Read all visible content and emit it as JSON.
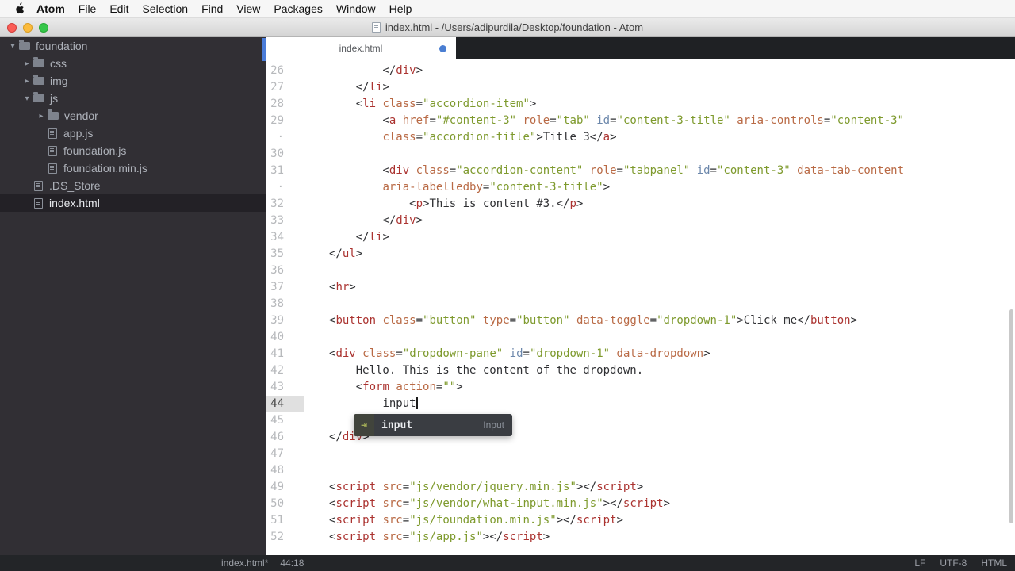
{
  "colors": {
    "accent_blue": "#4a7ed2",
    "tree_selection": "#232126",
    "tag_red": "#ab3330",
    "attr_orange": "#b96a45",
    "id_blue": "#6c87ab",
    "string_green": "#7e9a2d"
  },
  "menubar": {
    "app": "Atom",
    "items": [
      "File",
      "Edit",
      "Selection",
      "Find",
      "View",
      "Packages",
      "Window",
      "Help"
    ]
  },
  "titlebar": {
    "title": "index.html - /Users/adipurdila/Desktop/foundation - Atom"
  },
  "tree": {
    "items": [
      {
        "label": "foundation",
        "type": "folder",
        "depth": 0,
        "chevron": "down"
      },
      {
        "label": "css",
        "type": "folder",
        "depth": 1,
        "chevron": "right"
      },
      {
        "label": "img",
        "type": "folder",
        "depth": 1,
        "chevron": "right"
      },
      {
        "label": "js",
        "type": "folder",
        "depth": 1,
        "chevron": "down"
      },
      {
        "label": "vendor",
        "type": "folder",
        "depth": 2,
        "chevron": "right"
      },
      {
        "label": "app.js",
        "type": "file",
        "depth": 2
      },
      {
        "label": "foundation.js",
        "type": "file",
        "depth": 2
      },
      {
        "label": "foundation.min.js",
        "type": "file",
        "depth": 2
      },
      {
        "label": ".DS_Store",
        "type": "file",
        "depth": 1
      },
      {
        "label": "index.html",
        "type": "file",
        "depth": 1,
        "selected": true
      }
    ]
  },
  "tab": {
    "label": "index.html",
    "modified": true
  },
  "editor": {
    "rows": [
      {
        "n": "26",
        "i": 8,
        "t": [
          [
            "p",
            "</"
          ],
          [
            "t",
            "div"
          ],
          [
            "p",
            ">"
          ]
        ]
      },
      {
        "n": "27",
        "i": 4,
        "t": [
          [
            "p",
            "</"
          ],
          [
            "t",
            "li"
          ],
          [
            "p",
            ">"
          ]
        ]
      },
      {
        "n": "28",
        "i": 4,
        "t": [
          [
            "p",
            "<"
          ],
          [
            "t",
            "li"
          ],
          [
            "x",
            " "
          ],
          [
            "a",
            "class"
          ],
          [
            "p",
            "="
          ],
          [
            "s",
            "\"accordion-item\""
          ],
          [
            "p",
            ">"
          ]
        ]
      },
      {
        "n": "29",
        "i": 8,
        "t": [
          [
            "p",
            "<"
          ],
          [
            "t",
            "a"
          ],
          [
            "x",
            " "
          ],
          [
            "a",
            "href"
          ],
          [
            "p",
            "="
          ],
          [
            "s",
            "\"#content-3\""
          ],
          [
            "x",
            " "
          ],
          [
            "a",
            "role"
          ],
          [
            "p",
            "="
          ],
          [
            "s",
            "\"tab\""
          ],
          [
            "x",
            " "
          ],
          [
            "i",
            "id"
          ],
          [
            "p",
            "="
          ],
          [
            "s",
            "\"content-3-title\""
          ],
          [
            "x",
            " "
          ],
          [
            "a",
            "aria-controls"
          ],
          [
            "p",
            "="
          ],
          [
            "s",
            "\"content-3\""
          ]
        ]
      },
      {
        "n": "·",
        "i": 8,
        "t": [
          [
            "a",
            "class"
          ],
          [
            "p",
            "="
          ],
          [
            "s",
            "\"accordion-title\""
          ],
          [
            "p",
            ">"
          ],
          [
            "x",
            "Title 3"
          ],
          [
            "p",
            "</"
          ],
          [
            "t",
            "a"
          ],
          [
            "p",
            ">"
          ]
        ]
      },
      {
        "n": "30",
        "i": 0,
        "t": []
      },
      {
        "n": "31",
        "i": 8,
        "t": [
          [
            "p",
            "<"
          ],
          [
            "t",
            "div"
          ],
          [
            "x",
            " "
          ],
          [
            "a",
            "class"
          ],
          [
            "p",
            "="
          ],
          [
            "s",
            "\"accordion-content\""
          ],
          [
            "x",
            " "
          ],
          [
            "a",
            "role"
          ],
          [
            "p",
            "="
          ],
          [
            "s",
            "\"tabpanel\""
          ],
          [
            "x",
            " "
          ],
          [
            "i",
            "id"
          ],
          [
            "p",
            "="
          ],
          [
            "s",
            "\"content-3\""
          ],
          [
            "x",
            " "
          ],
          [
            "a",
            "data-tab-content"
          ]
        ]
      },
      {
        "n": "·",
        "i": 8,
        "t": [
          [
            "a",
            "aria-labelledby"
          ],
          [
            "p",
            "="
          ],
          [
            "s",
            "\"content-3-title\""
          ],
          [
            "p",
            ">"
          ]
        ]
      },
      {
        "n": "32",
        "i": 12,
        "t": [
          [
            "p",
            "<"
          ],
          [
            "t",
            "p"
          ],
          [
            "p",
            ">"
          ],
          [
            "x",
            "This is content #3."
          ],
          [
            "p",
            "</"
          ],
          [
            "t",
            "p"
          ],
          [
            "p",
            ">"
          ]
        ]
      },
      {
        "n": "33",
        "i": 8,
        "t": [
          [
            "p",
            "</"
          ],
          [
            "t",
            "div"
          ],
          [
            "p",
            ">"
          ]
        ]
      },
      {
        "n": "34",
        "i": 4,
        "t": [
          [
            "p",
            "</"
          ],
          [
            "t",
            "li"
          ],
          [
            "p",
            ">"
          ]
        ]
      },
      {
        "n": "35",
        "i": 0,
        "t": [
          [
            "p",
            "</"
          ],
          [
            "t",
            "ul"
          ],
          [
            "p",
            ">"
          ]
        ]
      },
      {
        "n": "36",
        "i": 0,
        "t": []
      },
      {
        "n": "37",
        "i": 0,
        "t": [
          [
            "p",
            "<"
          ],
          [
            "t",
            "hr"
          ],
          [
            "p",
            ">"
          ]
        ]
      },
      {
        "n": "38",
        "i": 0,
        "t": []
      },
      {
        "n": "39",
        "i": 0,
        "t": [
          [
            "p",
            "<"
          ],
          [
            "t",
            "button"
          ],
          [
            "x",
            " "
          ],
          [
            "a",
            "class"
          ],
          [
            "p",
            "="
          ],
          [
            "s",
            "\"button\""
          ],
          [
            "x",
            " "
          ],
          [
            "a",
            "type"
          ],
          [
            "p",
            "="
          ],
          [
            "s",
            "\"button\""
          ],
          [
            "x",
            " "
          ],
          [
            "a",
            "data-toggle"
          ],
          [
            "p",
            "="
          ],
          [
            "s",
            "\"dropdown-1\""
          ],
          [
            "p",
            ">"
          ],
          [
            "x",
            "Click me"
          ],
          [
            "p",
            "</"
          ],
          [
            "t",
            "button"
          ],
          [
            "p",
            ">"
          ]
        ]
      },
      {
        "n": "40",
        "i": 0,
        "t": []
      },
      {
        "n": "41",
        "i": 0,
        "t": [
          [
            "p",
            "<"
          ],
          [
            "t",
            "div"
          ],
          [
            "x",
            " "
          ],
          [
            "a",
            "class"
          ],
          [
            "p",
            "="
          ],
          [
            "s",
            "\"dropdown-pane\""
          ],
          [
            "x",
            " "
          ],
          [
            "i",
            "id"
          ],
          [
            "p",
            "="
          ],
          [
            "s",
            "\"dropdown-1\""
          ],
          [
            "x",
            " "
          ],
          [
            "a",
            "data-dropdown"
          ],
          [
            "p",
            ">"
          ]
        ]
      },
      {
        "n": "42",
        "i": 4,
        "t": [
          [
            "x",
            "Hello. This is the content of the dropdown."
          ]
        ]
      },
      {
        "n": "43",
        "i": 4,
        "t": [
          [
            "p",
            "<"
          ],
          [
            "t",
            "form"
          ],
          [
            "x",
            " "
          ],
          [
            "a",
            "action"
          ],
          [
            "p",
            "="
          ],
          [
            "s",
            "\"\""
          ],
          [
            "p",
            ">"
          ]
        ]
      },
      {
        "n": "44",
        "i": 8,
        "t": [
          [
            "x",
            "input"
          ]
        ],
        "active": 1,
        "cursor": 1
      },
      {
        "n": "45",
        "i": 0,
        "t": []
      },
      {
        "n": "46",
        "i": 0,
        "t": [
          [
            "p",
            "</"
          ],
          [
            "t",
            "div"
          ],
          [
            "p",
            ">"
          ]
        ]
      },
      {
        "n": "47",
        "i": 0,
        "t": []
      },
      {
        "n": "48",
        "i": 0,
        "t": []
      },
      {
        "n": "49",
        "i": 0,
        "t": [
          [
            "p",
            "<"
          ],
          [
            "t",
            "script"
          ],
          [
            "x",
            " "
          ],
          [
            "a",
            "src"
          ],
          [
            "p",
            "="
          ],
          [
            "s",
            "\"js/vendor/jquery.min.js\""
          ],
          [
            "p",
            ">"
          ],
          [
            "p",
            "</"
          ],
          [
            "t",
            "script"
          ],
          [
            "p",
            ">"
          ]
        ]
      },
      {
        "n": "50",
        "i": 0,
        "t": [
          [
            "p",
            "<"
          ],
          [
            "t",
            "script"
          ],
          [
            "x",
            " "
          ],
          [
            "a",
            "src"
          ],
          [
            "p",
            "="
          ],
          [
            "s",
            "\"js/vendor/what-input.min.js\""
          ],
          [
            "p",
            ">"
          ],
          [
            "p",
            "</"
          ],
          [
            "t",
            "script"
          ],
          [
            "p",
            ">"
          ]
        ]
      },
      {
        "n": "51",
        "i": 0,
        "t": [
          [
            "p",
            "<"
          ],
          [
            "t",
            "script"
          ],
          [
            "x",
            " "
          ],
          [
            "a",
            "src"
          ],
          [
            "p",
            "="
          ],
          [
            "s",
            "\"js/foundation.min.js\""
          ],
          [
            "p",
            ">"
          ],
          [
            "p",
            "</"
          ],
          [
            "t",
            "script"
          ],
          [
            "p",
            ">"
          ]
        ]
      },
      {
        "n": "52",
        "i": 0,
        "t": [
          [
            "p",
            "<"
          ],
          [
            "t",
            "script"
          ],
          [
            "x",
            " "
          ],
          [
            "a",
            "src"
          ],
          [
            "p",
            "="
          ],
          [
            "s",
            "\"js/app.js\""
          ],
          [
            "p",
            ">"
          ],
          [
            "p",
            "</"
          ],
          [
            "t",
            "script"
          ],
          [
            "p",
            ">"
          ]
        ]
      }
    ]
  },
  "autocomplete": {
    "icon": "⇥",
    "word": "input",
    "kind": "Input"
  },
  "statusbar": {
    "file": "index.html*",
    "position": "44:18",
    "line_ending": "LF",
    "encoding": "UTF-8",
    "grammar": "HTML"
  }
}
